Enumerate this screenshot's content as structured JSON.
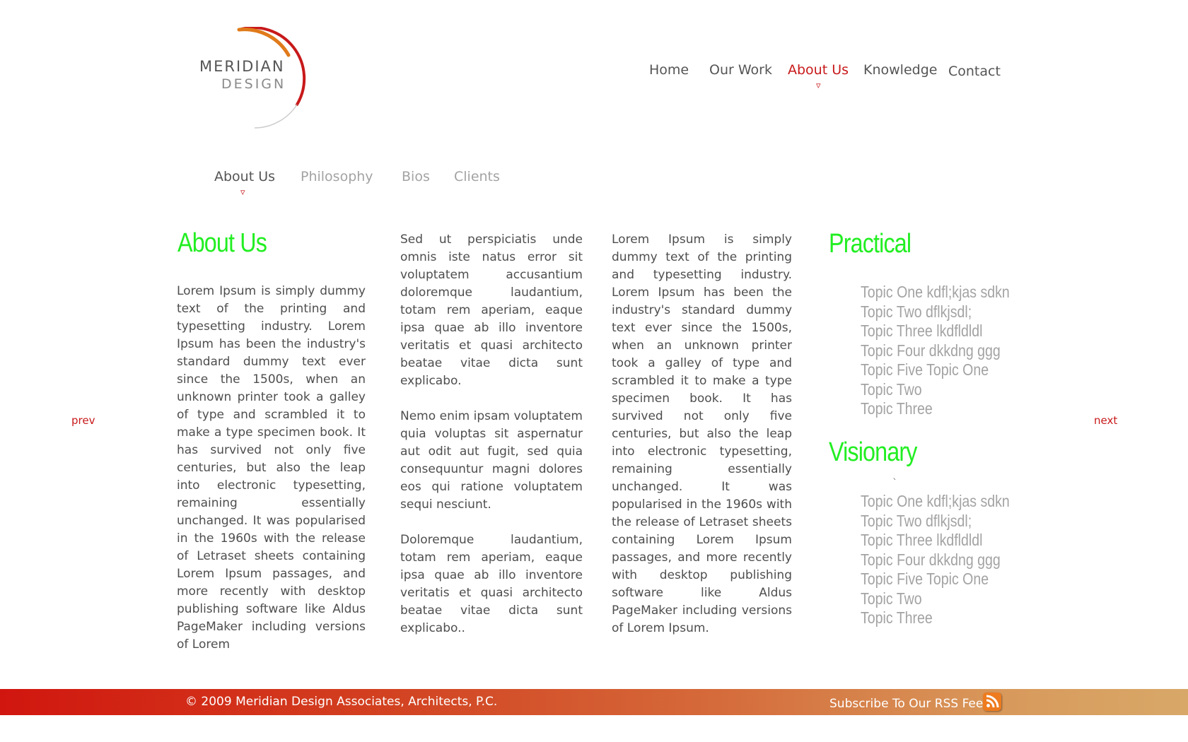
{
  "brand": {
    "line1": "MERIDIAN",
    "line2": "DESIGN",
    "accent": "#c8191a"
  },
  "main_nav": {
    "items": [
      {
        "label": "Home"
      },
      {
        "label": "Our Work"
      },
      {
        "label": "About Us",
        "active": true
      },
      {
        "label": "Knowledge"
      },
      {
        "label": "Contact"
      }
    ],
    "marker": "▿"
  },
  "sub_nav": {
    "items": [
      {
        "label": "About Us",
        "active": true
      },
      {
        "label": "Philosophy"
      },
      {
        "label": "Bios"
      },
      {
        "label": "Clients"
      }
    ],
    "marker": "▿"
  },
  "content": {
    "heading": "About Us",
    "col1": "Lorem Ipsum is simply dummy text of the printing and typesetting industry. Lorem Ipsum has been the industry's standard dummy text ever since the 1500s, when an unknown printer took a galley of type and scrambled it to make a type specimen book. It has survived not only five centuries, but also the leap into electronic typesetting, remaining essentially unchanged. It was popularised in the 1960s with the release of Letraset sheets containing Lorem Ipsum passages, and more recently with desktop publishing software like Aldus PageMaker including versions of Lorem",
    "col2": [
      "Sed ut perspiciatis unde omnis iste natus error sit voluptatem accusantium doloremque laudantium, totam rem aperiam, eaque ipsa quae ab illo inventore veritatis et quasi architecto beatae vitae dicta sunt explicabo.",
      "Nemo enim ipsam voluptatem quia voluptas sit aspernatur aut odit aut fugit, sed quia consequuntur magni dolores eos qui ratione voluptatem sequi nesciunt.",
      "Doloremque laudantium, totam rem aperiam, eaque ipsa quae ab illo inventore veritatis et quasi architecto beatae vitae dicta sunt explicabo.."
    ],
    "col3": "Lorem Ipsum is simply dummy text of the printing and typesetting industry. Lorem Ipsum has been the industry's standard dummy text ever since the 1500s, when an unknown printer took a galley of type and scrambled it to make a type specimen book. It has survived not only five centuries, but also the leap into electronic typesetting, remaining essentially unchanged. It was popularised in the 1960s with the release of Letraset sheets containing Lorem Ipsum passages, and more recently with desktop publishing software like Aldus PageMaker including versions of Lorem Ipsum."
  },
  "sidebar": {
    "practical": {
      "heading": "Practical",
      "topics": [
        "Topic One kdfl;kjas sdkn",
        "Topic Two dflkjsdl;",
        "Topic Three lkdfldldl",
        "Topic Four dkkdng ggg",
        "Topic Five Topic One",
        "Topic Two",
        "Topic Three"
      ]
    },
    "visionary": {
      "heading": "Visionary",
      "tick": "`",
      "topics": [
        "Topic One kdfl;kjas sdkn",
        "Topic Two dflkjsdl;",
        "Topic Three lkdfldldl",
        "Topic Four dkkdng ggg",
        "Topic Five Topic One",
        "Topic Two",
        "Topic Three"
      ]
    }
  },
  "pager": {
    "prev": "prev",
    "next": "next"
  },
  "footer": {
    "copyright": "© 2009 Meridian Design Associates, Architects, P.C.",
    "rss_label": "Subscribe To Our RSS Feed",
    "rss_icon": "rss-icon"
  },
  "colors": {
    "heading_green": "#22ee22",
    "accent_red": "#c8191a",
    "topic_gray": "#a3a3a3",
    "footer_start": "#d1160f",
    "footer_end": "#d8a868"
  }
}
